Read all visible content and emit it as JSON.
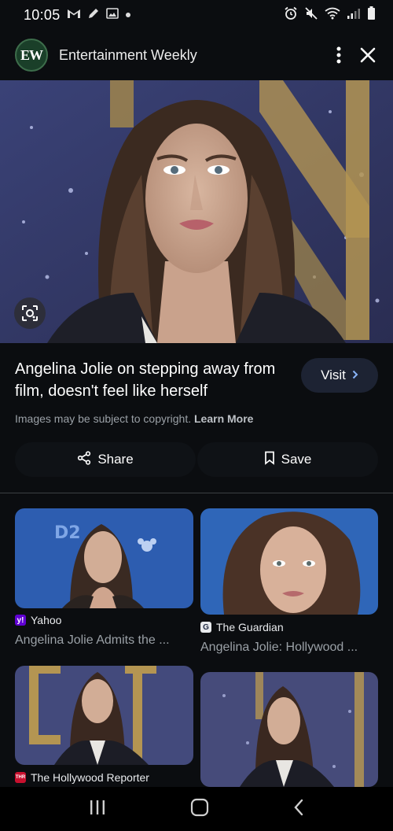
{
  "status": {
    "time": "10:05"
  },
  "app_bar": {
    "logo_text": "EW",
    "title": "Entertainment Weekly"
  },
  "result": {
    "headline": "Angelina Jolie on stepping away from film, doesn't feel like herself",
    "visit_label": "Visit",
    "copyright_text": "Images may be subject to copyright.",
    "learn_more": "Learn More",
    "share_label": "Share",
    "save_label": "Save"
  },
  "related": [
    {
      "source": "Yahoo",
      "source_icon": "y!",
      "source_color": "#6001d2",
      "title": "Angelina Jolie Admits the ..."
    },
    {
      "source": "The Guardian",
      "source_icon": "G",
      "source_color": "#1f2a44",
      "title": "Angelina Jolie: Hollywood ..."
    },
    {
      "source": "The Hollywood Reporter",
      "source_icon": "THR",
      "source_color": "#c8102e",
      "title": ""
    },
    {
      "source": "",
      "source_icon": "",
      "source_color": "",
      "title": ""
    }
  ],
  "colors": {
    "background": "#0b0d10",
    "visit_button": "#1d2333",
    "accent": "#8ab4f8"
  }
}
